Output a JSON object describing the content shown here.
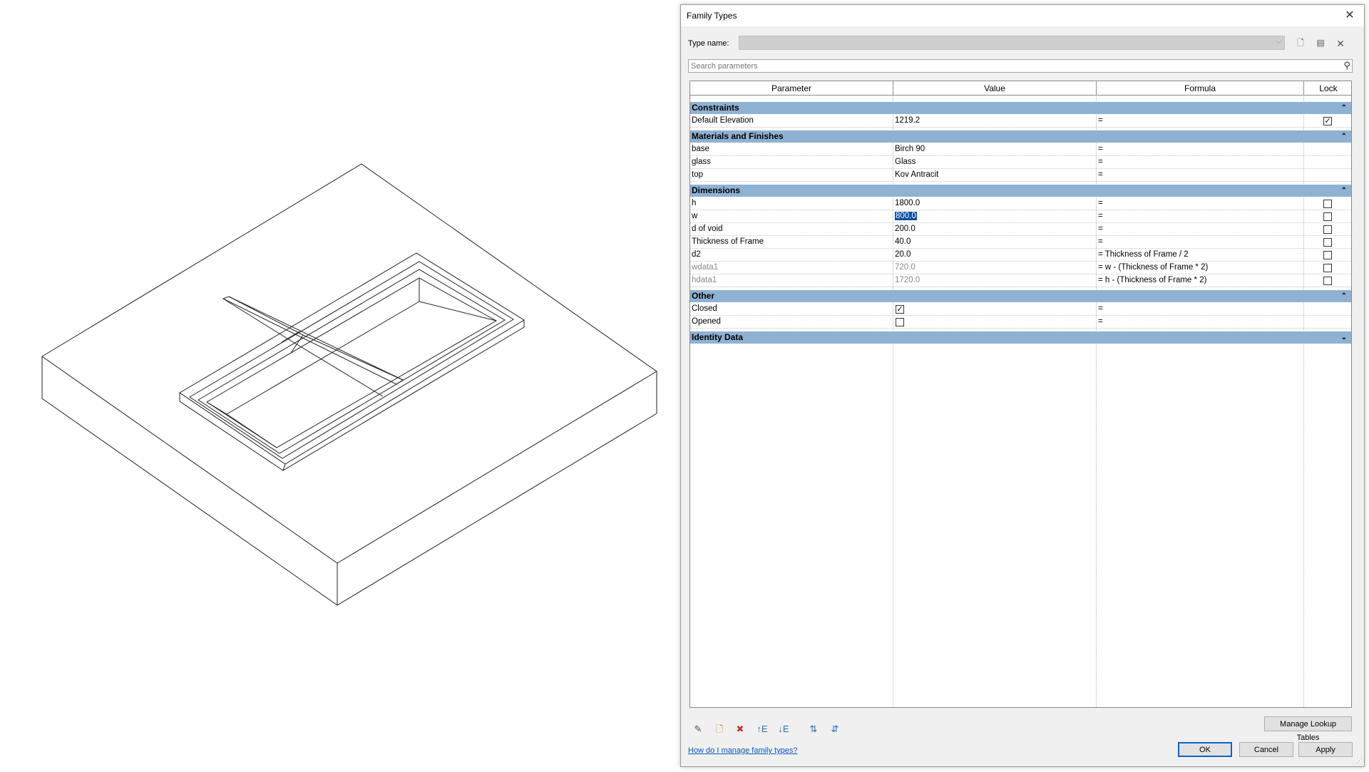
{
  "dialog": {
    "title": "Family Types",
    "close_icon": "close-icon",
    "type_name_label": "Type name:",
    "type_name_value": "",
    "search_placeholder": "Search parameters",
    "columns": [
      "Parameter",
      "Value",
      "Formula",
      "Lock"
    ],
    "groups": [
      {
        "name": "Constraints",
        "collapsed": false,
        "rows": [
          {
            "parameter": "Default Elevation",
            "value": "1219.2",
            "formula": "=",
            "lock": "checked"
          }
        ]
      },
      {
        "name": "Materials and Finishes",
        "collapsed": false,
        "rows": [
          {
            "parameter": "base",
            "value": "Birch 90",
            "formula": "=",
            "lock": "none"
          },
          {
            "parameter": "glass",
            "value": "Glass",
            "formula": "=",
            "lock": "none"
          },
          {
            "parameter": "top",
            "value": "Kov Antracit",
            "formula": "=",
            "lock": "none"
          }
        ]
      },
      {
        "name": "Dimensions",
        "collapsed": false,
        "rows": [
          {
            "parameter": "h",
            "value": "1800.0",
            "formula": "=",
            "lock": "unchecked"
          },
          {
            "parameter": "w",
            "value": "800.0",
            "formula": "=",
            "lock": "unchecked",
            "selected": true
          },
          {
            "parameter": "d of void",
            "value": "200.0",
            "formula": "=",
            "lock": "unchecked"
          },
          {
            "parameter": "Thickness of Frame",
            "value": "40.0",
            "formula": "=",
            "lock": "unchecked"
          },
          {
            "parameter": "d2",
            "value": "20.0",
            "formula": "= Thickness of Frame / 2",
            "lock": "unchecked"
          },
          {
            "parameter": "wdata1",
            "value": "720.0",
            "formula": "= w - (Thickness of Frame * 2)",
            "lock": "unchecked",
            "dimmed": true
          },
          {
            "parameter": "hdata1",
            "value": "1720.0",
            "formula": "= h - (Thickness of Frame * 2)",
            "lock": "unchecked",
            "dimmed": true
          }
        ]
      },
      {
        "name": "Other",
        "collapsed": false,
        "rows": [
          {
            "parameter": "Closed",
            "value": "checked",
            "formula": "=",
            "lock": "none",
            "value_is_checkbox": true
          },
          {
            "parameter": "Opened",
            "value": "unchecked",
            "formula": "=",
            "lock": "none",
            "value_is_checkbox": true
          }
        ]
      },
      {
        "name": "Identity Data",
        "collapsed": true,
        "rows": []
      }
    ],
    "manage_lookup_label": "Manage Lookup Tables",
    "help_link": "How do I manage family types?",
    "ok_label": "OK",
    "cancel_label": "Cancel",
    "apply_label": "Apply",
    "toolbar_icons": [
      "edit-parameter-icon",
      "new-parameter-icon",
      "delete-parameter-icon",
      "move-up-icon",
      "move-down-icon",
      "sort-ascending-icon",
      "sort-descending-icon"
    ],
    "type_icons": [
      "new-type-icon",
      "rename-type-icon",
      "delete-type-icon"
    ]
  },
  "colors": {
    "group_header": "#8fb1d3",
    "selection": "#0a4f9e",
    "dialog_bg": "#f0f0f0",
    "link": "#0b57b8"
  }
}
